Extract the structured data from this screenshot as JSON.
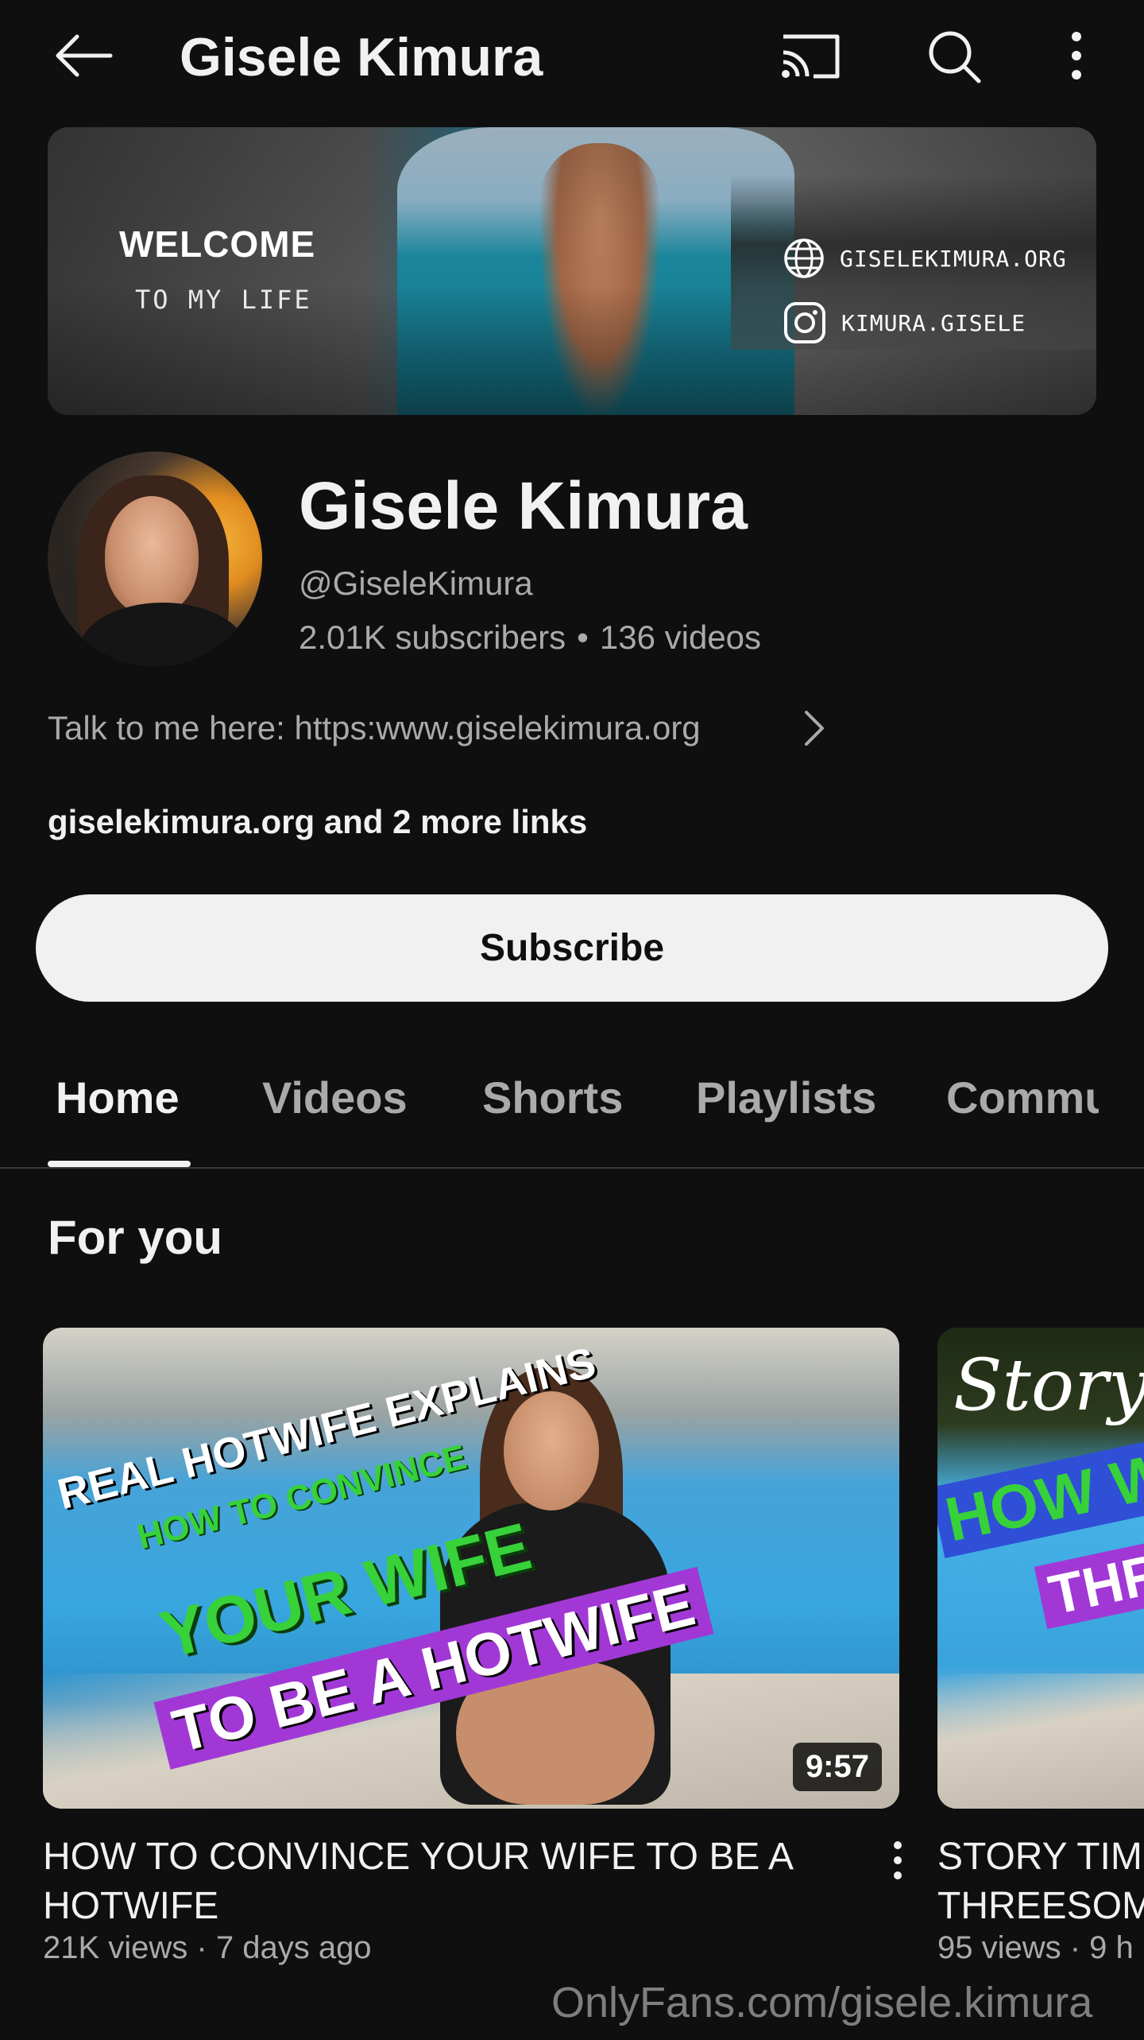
{
  "header": {
    "title": "Gisele Kimura",
    "icons": [
      "back-arrow-icon",
      "cast-icon",
      "search-icon",
      "more-vert-icon"
    ]
  },
  "banner": {
    "welcome": "WELCOME",
    "welcome_sub": "TO MY LIFE",
    "site_link": "GISELEKIMURA.ORG",
    "instagram": "KIMURA.GISELE"
  },
  "channel": {
    "name": "Gisele Kimura",
    "handle": "@GiseleKimura",
    "subscribers": "2.01K subscribers",
    "separator": "•",
    "videos": "136 videos",
    "about": "Talk to me here: https:www.giselekimura.org",
    "links": "giselekimura.org and 2 more links",
    "subscribe_label": "Subscribe"
  },
  "tabs": [
    {
      "label": "Home",
      "active": true
    },
    {
      "label": "Videos",
      "active": false
    },
    {
      "label": "Shorts",
      "active": false
    },
    {
      "label": "Playlists",
      "active": false
    },
    {
      "label": "Commu",
      "active": false
    }
  ],
  "section": {
    "title": "For you"
  },
  "videos": [
    {
      "thumb_text": [
        "REAL HOTWIFE EXPLAINS",
        "HOW TO CONVINCE",
        "YOUR WIFE",
        "TO BE A HOTWIFE"
      ],
      "duration": "9:57",
      "title": "HOW TO CONVINCE YOUR WIFE TO BE A HOTWIFE",
      "meta": "21K views · 7 days ago"
    },
    {
      "thumb_text": [
        "Storyt",
        "HOW WAS",
        "THRE"
      ],
      "title_line1": "STORY TIM",
      "title_line2": "THREESOM",
      "meta": "95 views · 9 h"
    }
  ],
  "watermark": "OnlyFans.com/gisele.kimura",
  "colors": {
    "background": "#0f0f0f",
    "text_primary": "#f1f1f1",
    "text_secondary": "#aaaaaa",
    "subscribe_bg": "#f1f1f1"
  }
}
